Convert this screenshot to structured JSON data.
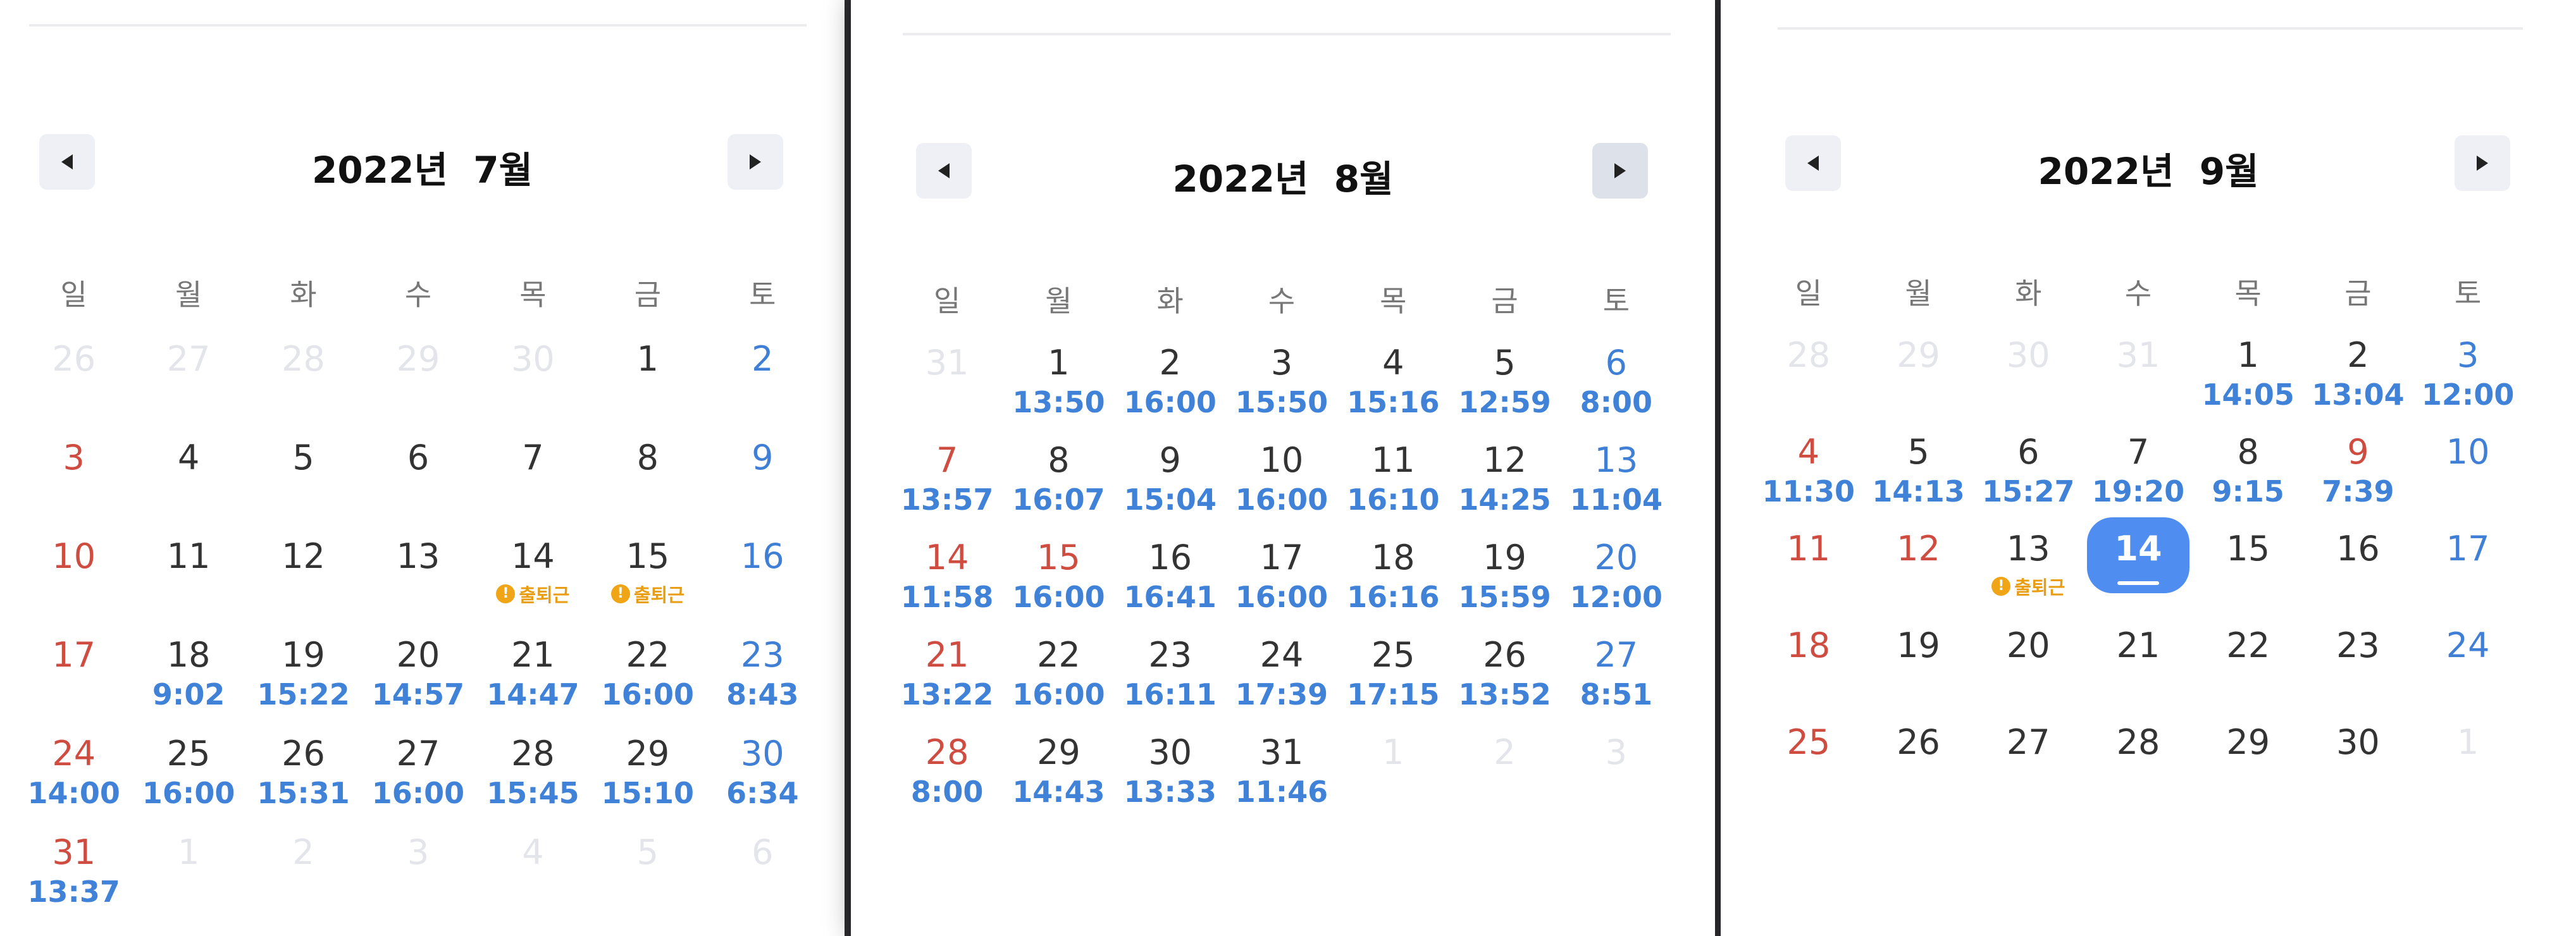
{
  "calendars": [
    {
      "title": "2022년  7월",
      "weekdays": [
        "일",
        "월",
        "화",
        "수",
        "목",
        "금",
        "토"
      ],
      "days": [
        {
          "n": "26",
          "o": true
        },
        {
          "n": "27",
          "o": true
        },
        {
          "n": "28",
          "o": true
        },
        {
          "n": "29",
          "o": true
        },
        {
          "n": "30",
          "o": true
        },
        {
          "n": "1"
        },
        {
          "n": "2"
        },
        {
          "n": "3"
        },
        {
          "n": "4"
        },
        {
          "n": "5"
        },
        {
          "n": "6"
        },
        {
          "n": "7"
        },
        {
          "n": "8"
        },
        {
          "n": "9"
        },
        {
          "n": "10"
        },
        {
          "n": "11"
        },
        {
          "n": "12"
        },
        {
          "n": "13"
        },
        {
          "n": "14",
          "b": "출퇴근"
        },
        {
          "n": "15",
          "b": "출퇴근"
        },
        {
          "n": "16"
        },
        {
          "n": "17"
        },
        {
          "n": "18",
          "t": "9:02"
        },
        {
          "n": "19",
          "t": "15:22"
        },
        {
          "n": "20",
          "t": "14:57"
        },
        {
          "n": "21",
          "t": "14:47"
        },
        {
          "n": "22",
          "t": "16:00"
        },
        {
          "n": "23",
          "t": "8:43"
        },
        {
          "n": "24",
          "t": "14:00"
        },
        {
          "n": "25",
          "t": "16:00"
        },
        {
          "n": "26",
          "t": "15:31"
        },
        {
          "n": "27",
          "t": "16:00"
        },
        {
          "n": "28",
          "t": "15:45"
        },
        {
          "n": "29",
          "t": "15:10"
        },
        {
          "n": "30",
          "t": "6:34"
        },
        {
          "n": "31",
          "t": "13:37"
        },
        {
          "n": "1",
          "o": true
        },
        {
          "n": "2",
          "o": true
        },
        {
          "n": "3",
          "o": true
        },
        {
          "n": "4",
          "o": true
        },
        {
          "n": "5",
          "o": true
        },
        {
          "n": "6",
          "o": true
        }
      ]
    },
    {
      "title": "2022년  8월",
      "weekdays": [
        "일",
        "월",
        "화",
        "수",
        "목",
        "금",
        "토"
      ],
      "days": [
        {
          "n": "31",
          "o": true
        },
        {
          "n": "1",
          "t": "13:50"
        },
        {
          "n": "2",
          "t": "16:00"
        },
        {
          "n": "3",
          "t": "15:50"
        },
        {
          "n": "4",
          "t": "15:16"
        },
        {
          "n": "5",
          "t": "12:59"
        },
        {
          "n": "6",
          "t": "8:00"
        },
        {
          "n": "7",
          "t": "13:57"
        },
        {
          "n": "8",
          "t": "16:07"
        },
        {
          "n": "9",
          "t": "15:04"
        },
        {
          "n": "10",
          "t": "16:00"
        },
        {
          "n": "11",
          "t": "16:10"
        },
        {
          "n": "12",
          "t": "14:25"
        },
        {
          "n": "13",
          "t": "11:04"
        },
        {
          "n": "14",
          "t": "11:58"
        },
        {
          "n": "15",
          "t": "16:00",
          "h": true
        },
        {
          "n": "16",
          "t": "16:41"
        },
        {
          "n": "17",
          "t": "16:00"
        },
        {
          "n": "18",
          "t": "16:16"
        },
        {
          "n": "19",
          "t": "15:59"
        },
        {
          "n": "20",
          "t": "12:00"
        },
        {
          "n": "21",
          "t": "13:22"
        },
        {
          "n": "22",
          "t": "16:00"
        },
        {
          "n": "23",
          "t": "16:11"
        },
        {
          "n": "24",
          "t": "17:39"
        },
        {
          "n": "25",
          "t": "17:15"
        },
        {
          "n": "26",
          "t": "13:52"
        },
        {
          "n": "27",
          "t": "8:51"
        },
        {
          "n": "28",
          "t": "8:00"
        },
        {
          "n": "29",
          "t": "14:43"
        },
        {
          "n": "30",
          "t": "13:33"
        },
        {
          "n": "31",
          "t": "11:46"
        },
        {
          "n": "1",
          "o": true
        },
        {
          "n": "2",
          "o": true
        },
        {
          "n": "3",
          "o": true
        }
      ]
    },
    {
      "title": "2022년  9월",
      "weekdays": [
        "일",
        "월",
        "화",
        "수",
        "목",
        "금",
        "토"
      ],
      "days": [
        {
          "n": "28",
          "o": true
        },
        {
          "n": "29",
          "o": true
        },
        {
          "n": "30",
          "o": true
        },
        {
          "n": "31",
          "o": true
        },
        {
          "n": "1",
          "t": "14:05"
        },
        {
          "n": "2",
          "t": "13:04"
        },
        {
          "n": "3",
          "t": "12:00"
        },
        {
          "n": "4",
          "t": "11:30"
        },
        {
          "n": "5",
          "t": "14:13"
        },
        {
          "n": "6",
          "t": "15:27"
        },
        {
          "n": "7",
          "t": "19:20"
        },
        {
          "n": "8",
          "t": "9:15"
        },
        {
          "n": "9",
          "t": "7:39",
          "h": true
        },
        {
          "n": "10"
        },
        {
          "n": "11"
        },
        {
          "n": "12",
          "h": true
        },
        {
          "n": "13",
          "b": "출퇴근"
        },
        {
          "n": "14",
          "today": true
        },
        {
          "n": "15"
        },
        {
          "n": "16"
        },
        {
          "n": "17"
        },
        {
          "n": "18"
        },
        {
          "n": "19"
        },
        {
          "n": "20"
        },
        {
          "n": "21"
        },
        {
          "n": "22"
        },
        {
          "n": "23"
        },
        {
          "n": "24"
        },
        {
          "n": "25"
        },
        {
          "n": "26"
        },
        {
          "n": "27"
        },
        {
          "n": "28"
        },
        {
          "n": "29"
        },
        {
          "n": "30"
        },
        {
          "n": "1",
          "o": true
        }
      ]
    }
  ],
  "colors": {
    "sunday": "#cf4c41",
    "saturday": "#3f7fd6",
    "time": "#3f82d8",
    "other_month": "#e3e5ea",
    "today_bg": "#4f8df0",
    "badge": "#e89d12",
    "legend_dots": [
      "#8e4fd6",
      "#3fae49",
      "#3ab8de",
      "#f2a92c",
      "#d9473b"
    ]
  },
  "badge_icon": "!",
  "icons": {
    "prev": "chevron-left-icon",
    "next": "chevron-right-icon",
    "badge": "alert-icon"
  }
}
